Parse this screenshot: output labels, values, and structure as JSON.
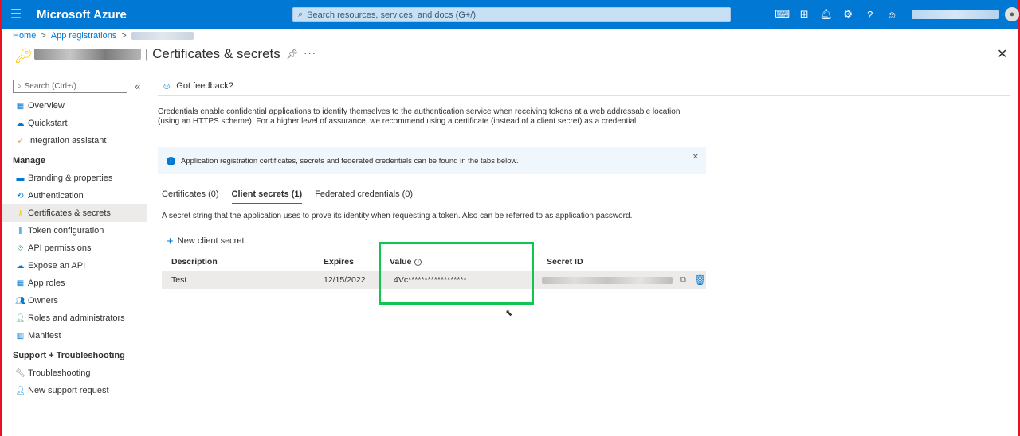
{
  "topbar": {
    "brand": "Microsoft Azure",
    "search_placeholder": "Search resources, services, and docs (G+/)",
    "icons": [
      "cloud-shell-icon",
      "directory-filter-icon",
      "notifications-icon",
      "settings-icon",
      "help-icon",
      "feedback-icon"
    ]
  },
  "breadcrumb": {
    "home": "Home",
    "app_registrations": "App registrations"
  },
  "page": {
    "title": "| Certificates & secrets",
    "more": "···",
    "close": "✕"
  },
  "sidebar": {
    "search_placeholder": "Search (Ctrl+/)",
    "collapse": "«",
    "top_items": [
      {
        "label": "Overview"
      },
      {
        "label": "Quickstart"
      },
      {
        "label": "Integration assistant"
      }
    ],
    "manage_heading": "Manage",
    "manage_items": [
      {
        "label": "Branding & properties"
      },
      {
        "label": "Authentication"
      },
      {
        "label": "Certificates & secrets"
      },
      {
        "label": "Token configuration"
      },
      {
        "label": "API permissions"
      },
      {
        "label": "Expose an API"
      },
      {
        "label": "App roles"
      },
      {
        "label": "Owners"
      },
      {
        "label": "Roles and administrators"
      },
      {
        "label": "Manifest"
      }
    ],
    "support_heading": "Support + Troubleshooting",
    "support_items": [
      {
        "label": "Troubleshooting"
      },
      {
        "label": "New support request"
      }
    ]
  },
  "main": {
    "feedback": "Got feedback?",
    "description": "Credentials enable confidential applications to identify themselves to the authentication service when receiving tokens at a web addressable location (using an HTTPS scheme). For a higher level of assurance, we recommend using a certificate (instead of a client secret) as a credential.",
    "info_banner": "Application registration certificates, secrets and federated credentials can be found in the tabs below.",
    "tabs": [
      {
        "label": "Certificates (0)"
      },
      {
        "label": "Client secrets (1)"
      },
      {
        "label": "Federated credentials (0)"
      }
    ],
    "tab_description": "A secret string that the application uses to prove its identity when requesting a token. Also can be referred to as application password.",
    "new_secret": "New client secret",
    "table": {
      "headers": {
        "description": "Description",
        "expires": "Expires",
        "value": "Value",
        "secret_id": "Secret ID"
      },
      "rows": [
        {
          "description": "Test",
          "expires": "12/15/2022",
          "value": "4Vc******************"
        }
      ]
    }
  }
}
